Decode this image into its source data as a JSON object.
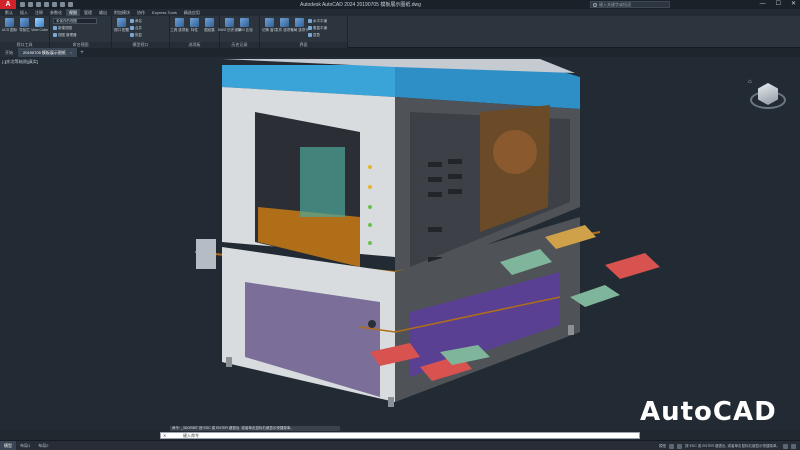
{
  "titlebar": {
    "app_logo": "A",
    "title": "Autodesk AutoCAD 2024   20190705 模板展示图纸.dwg",
    "search_placeholder": "键入关键字或短语",
    "win_min": "—",
    "win_max": "☐",
    "win_close": "✕"
  },
  "ribbon_tabs": [
    "默认",
    "插入",
    "注释",
    "参数化",
    "视图",
    "管理",
    "输出",
    "附加模块",
    "协作",
    "Express Tools",
    "精选应用"
  ],
  "ribbon_active_tab": 4,
  "ribbon": {
    "groups": [
      {
        "label": "视口工具",
        "buttons": [
          "UCS\n图标",
          "导航栏",
          "View\nCube"
        ]
      },
      {
        "label": "命名视图",
        "combo": "未保存的视图",
        "smalls": [
          "新建视图",
          "视图 管理器"
        ]
      },
      {
        "label": "模型视口",
        "buttons": [
          "视口\n配置",
          "命名",
          "合并",
          "恢复"
        ]
      },
      {
        "label": "选项板",
        "buttons": [
          "工具\n选项板",
          "特性",
          "图纸集"
        ]
      },
      {
        "label": "历史记录",
        "buttons": [
          "DWG\n历史记录",
          "DWG\n比较"
        ]
      },
      {
        "label": "界面",
        "buttons": [
          "切换\n窗口",
          "文件\n选项卡",
          "布局\n选项卡"
        ],
        "smalls": [
          "水平平铺",
          "垂直平铺",
          "层叠"
        ]
      }
    ]
  },
  "file_tabs": {
    "home": "开始",
    "active": "20190705 模板展示图纸",
    "close": "×",
    "plus": "+"
  },
  "viewport": {
    "label": "[-][东北等轴测][真实]"
  },
  "viewcube": {
    "home_icon": "⌂"
  },
  "watermark": "AutoCAD",
  "command": {
    "history": "命令: _3DORBIT 按 ESC 或 ENTER 键退出, 或者单击鼠标右键显示快捷菜单。",
    "close": "✕",
    "placeholder": "键入命令"
  },
  "layout_tabs": [
    "模型",
    "布局1",
    "布局2"
  ],
  "layout_active": 0,
  "status": {
    "coords": "模型",
    "text": "按 ESC 或 ENTER 键退出, 或者单击鼠标右键显示快捷菜单。"
  },
  "colors": {
    "background": "#222a33",
    "machine_top": "#3aa3d8",
    "frame": "#dcdcdc",
    "wood": "#b06e18",
    "purple": "#5a3e9a",
    "brand_red": "#d2232a"
  }
}
